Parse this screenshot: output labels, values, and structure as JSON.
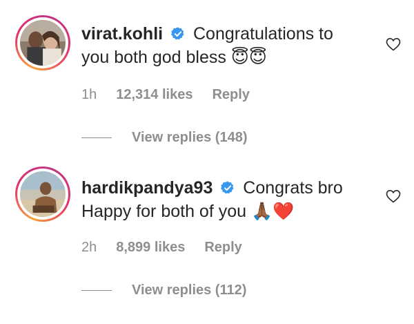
{
  "comments": [
    {
      "username": "virat.kohli",
      "text_line1": "Congratulations to",
      "text_line2": "you both god bless",
      "emoji": "😇😇",
      "time": "1h",
      "likes": "12,314 likes",
      "reply_label": "Reply",
      "view_replies": "View replies (148)",
      "icons": [
        "verified-icon",
        "heart-icon"
      ]
    },
    {
      "username": "hardikpandya93",
      "text_line1": "Congrats bro",
      "text_line2": "Happy for both of you",
      "emoji": "🙏🏾❤️",
      "time": "2h",
      "likes": "8,899 likes",
      "reply_label": "Reply",
      "view_replies": "View replies (112)",
      "icons": [
        "verified-icon",
        "heart-icon"
      ]
    }
  ],
  "colors": {
    "text": "#262626",
    "secondary": "#8e8e8e",
    "verified": "#3897f0"
  }
}
